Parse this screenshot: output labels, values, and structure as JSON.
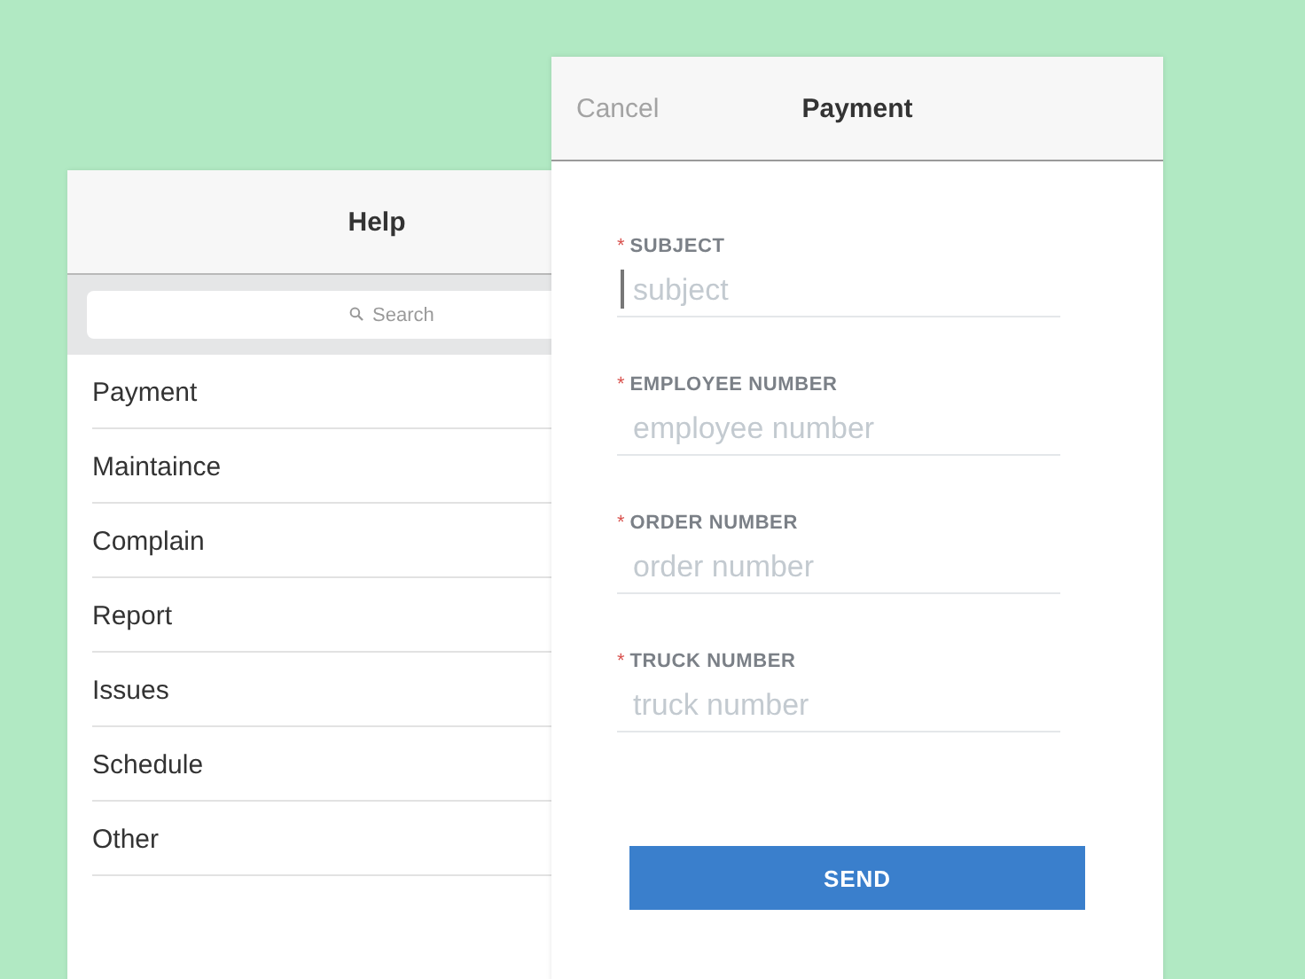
{
  "help_screen": {
    "title": "Help",
    "search": {
      "placeholder": "Search"
    },
    "items": [
      {
        "label": "Payment"
      },
      {
        "label": "Maintaince"
      },
      {
        "label": "Complain"
      },
      {
        "label": "Report"
      },
      {
        "label": "Issues"
      },
      {
        "label": "Schedule"
      },
      {
        "label": "Other"
      }
    ]
  },
  "payment_screen": {
    "cancel": "Cancel",
    "title": "Payment",
    "fields": [
      {
        "required_mark": "*",
        "label": "SUBJECT",
        "placeholder": "subject",
        "focused": true
      },
      {
        "required_mark": "*",
        "label": "EMPLOYEE NUMBER",
        "placeholder": "employee number",
        "focused": false
      },
      {
        "required_mark": "*",
        "label": "ORDER NUMBER",
        "placeholder": "order number",
        "focused": false
      },
      {
        "required_mark": "*",
        "label": "TRUCK NUMBER",
        "placeholder": "truck number",
        "focused": false
      }
    ],
    "button": "SEND"
  }
}
